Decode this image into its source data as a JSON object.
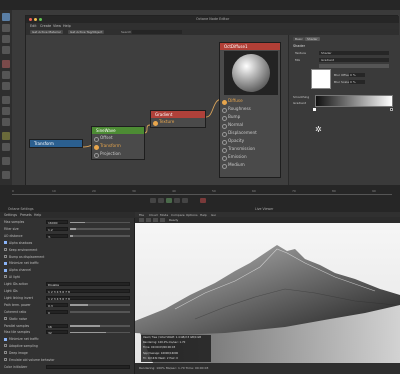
{
  "node_editor": {
    "window_title": "Octane Node Editor",
    "menu": [
      "Edit",
      "Create",
      "View",
      "Help"
    ],
    "toolbar": {
      "btn1": "Get Active Material",
      "btn2": "Get Active Tag/Object",
      "search_label": "Search"
    },
    "nodes": {
      "transform": {
        "title": "Transform"
      },
      "sinewave": {
        "title": "SineWave",
        "ports": [
          "Offset",
          "Transform",
          "Projection"
        ]
      },
      "gradient": {
        "title": "Gradient",
        "ports": [
          "Texture"
        ]
      },
      "material": {
        "title": "OctDiffuse1",
        "ports": [
          "Diffuse",
          "Roughness",
          "Bump",
          "Normal",
          "Displacement",
          "Opacity",
          "Transmission",
          "Emission",
          "Medium"
        ]
      }
    },
    "props": {
      "tabs": [
        "Basic",
        "Shader"
      ],
      "section": "Shader",
      "rows": [
        {
          "label": "Texture",
          "value": "Shader"
        },
        {
          "label": "Mix",
          "value": "Gradient"
        },
        {
          "label": "Blur Offset",
          "value": "0 %"
        },
        {
          "label": "Blur Scale",
          "value": "0 %"
        },
        {
          "label": "Interpolation",
          "value": ""
        },
        {
          "label": "Gradient",
          "value": ""
        }
      ],
      "colors": [
        "#ffffff",
        "#1a1a1a"
      ],
      "toggle_label": "Smoothing"
    }
  },
  "settings_panel": {
    "title": "Octane Settings",
    "tabs": [
      "Settings",
      "Presets",
      "Help"
    ],
    "rows": [
      {
        "label": "Max samples",
        "value": "16000",
        "fraction": 0.25
      },
      {
        "label": "Filter size",
        "value": "1.2",
        "fraction": 0.1
      },
      {
        "label": "AO distance",
        "value": "3.",
        "fraction": 0.05
      },
      {
        "label": "Alpha shadows",
        "check": true
      },
      {
        "label": "Keep environment",
        "check": false
      },
      {
        "label": "Bump as displacement",
        "check": false
      },
      {
        "label": "Minimize net traffic",
        "check": true
      },
      {
        "label": "Alpha channel",
        "check": true
      },
      {
        "label": "AI light",
        "check": false
      },
      {
        "label": "Light IDs action",
        "value": "Disable"
      },
      {
        "label": "Light IDs",
        "value": "1  2  3  4  5  6  7  8"
      },
      {
        "label": "Light linking invert",
        "value": "1  2  3  4  5  6  7  8"
      },
      {
        "label": "Path term. power",
        "value": "0.3",
        "fraction": 0.3
      },
      {
        "label": "Coherent ratio",
        "value": "0",
        "fraction": 0
      },
      {
        "label": "Static noise",
        "check": false
      },
      {
        "label": "Parallel samples",
        "value": "16",
        "fraction": 0.5
      },
      {
        "label": "Max tile samples",
        "value": "32",
        "fraction": 0.6
      },
      {
        "label": "Minimize net traffic",
        "check": true
      },
      {
        "label": "Adaptive sampling",
        "check": false
      },
      {
        "label": "Deep image",
        "check": false
      },
      {
        "label": "Emulate old volume behavior",
        "check": false
      },
      {
        "label": "Color initializer",
        "value": ""
      }
    ]
  },
  "viewer": {
    "title": "Live Viewer",
    "menu": [
      "File",
      "Cloud",
      "Mode",
      "Compare",
      "Options",
      "Help",
      "Gui"
    ],
    "render_label": "Ready",
    "hud": [
      "Used / free / total VRAM: 1.4 GB/2.5 GB/4 GB",
      "Rendering: 100.0%  ms/sec: 1.70",
      "Time: 00:00:03/00:00:03",
      "Spp/maxspp: 16000/16000",
      "Tri: 0/2.63k  Mesh: 2  Hair: 0"
    ],
    "status": "Rendering: 100%  Ms/sec: 1.70  Time: 00:00:03"
  },
  "timeline": {
    "ticks": [
      "0",
      "10",
      "20",
      "30",
      "40",
      "50",
      "60",
      "70",
      "80",
      "90"
    ]
  }
}
